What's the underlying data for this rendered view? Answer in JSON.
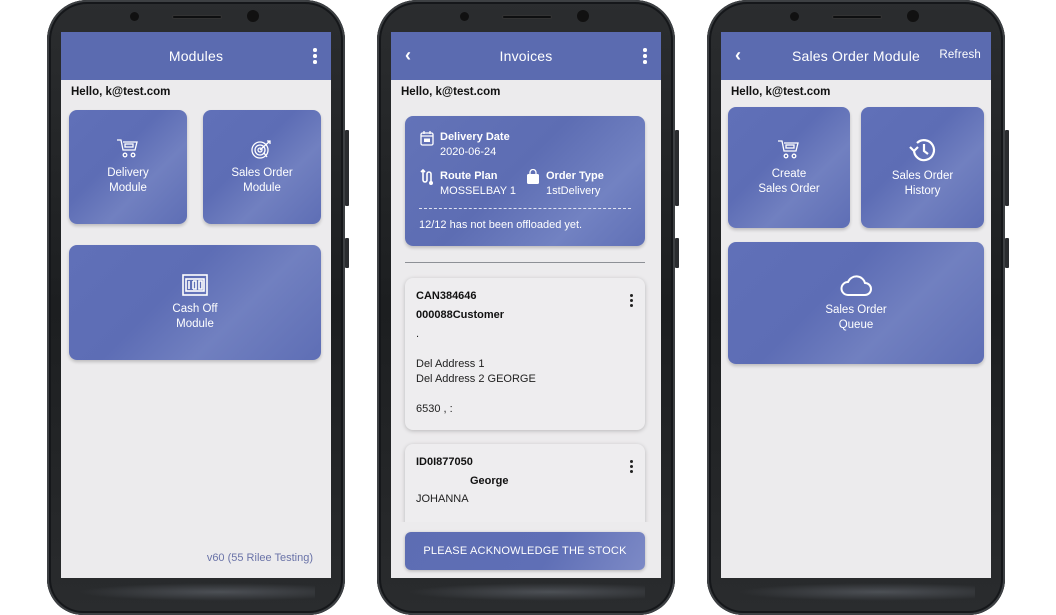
{
  "phones": [
    {
      "appbar": {
        "title": "Modules",
        "menu_icon": "kebab-menu-icon"
      },
      "greeting": "Hello, k@test.com",
      "tiles": [
        {
          "label": "Delivery\nModule",
          "icon": "cart-icon"
        },
        {
          "label": "Sales Order\nModule",
          "icon": "target-icon"
        },
        {
          "label": "Cash Off\nModule",
          "icon": "cash-note-icon"
        }
      ],
      "version": "v60 (55 Rilee Testing)"
    },
    {
      "appbar": {
        "title": "Invoices",
        "back_icon": "chevron-left-icon",
        "menu_icon": "kebab-menu-icon"
      },
      "greeting": "Hello, k@test.com",
      "summary": {
        "delivery_date_label": "Delivery Date",
        "delivery_date": "2020-06-24",
        "route_plan_label": "Route Plan",
        "route_plan": "MOSSELBAY 1",
        "order_type_label": "Order Type",
        "order_type": "1stDelivery",
        "note": "12/12 has not been offloaded yet."
      },
      "invoices": [
        {
          "id": "CAN384646",
          "customer": "000088Customer",
          "dot": ".",
          "address1": "Del Address 1",
          "address2": "Del Address 2 GEORGE",
          "postal": "6530 , :"
        },
        {
          "id": "ID0I877050",
          "customer": "George",
          "address1": "JOHANNA"
        }
      ],
      "ack_button": "PLEASE ACKNOWLEDGE THE STOCK"
    },
    {
      "appbar": {
        "title": "Sales Order Module",
        "back_icon": "chevron-left-icon",
        "action": "Refresh"
      },
      "greeting": "Hello, k@test.com",
      "tiles": [
        {
          "label": "Create\nSales Order",
          "icon": "cart-icon"
        },
        {
          "label": "Sales Order\nHistory",
          "icon": "history-icon"
        },
        {
          "label": "Sales Order\nQueue",
          "icon": "cloud-icon"
        }
      ]
    }
  ]
}
